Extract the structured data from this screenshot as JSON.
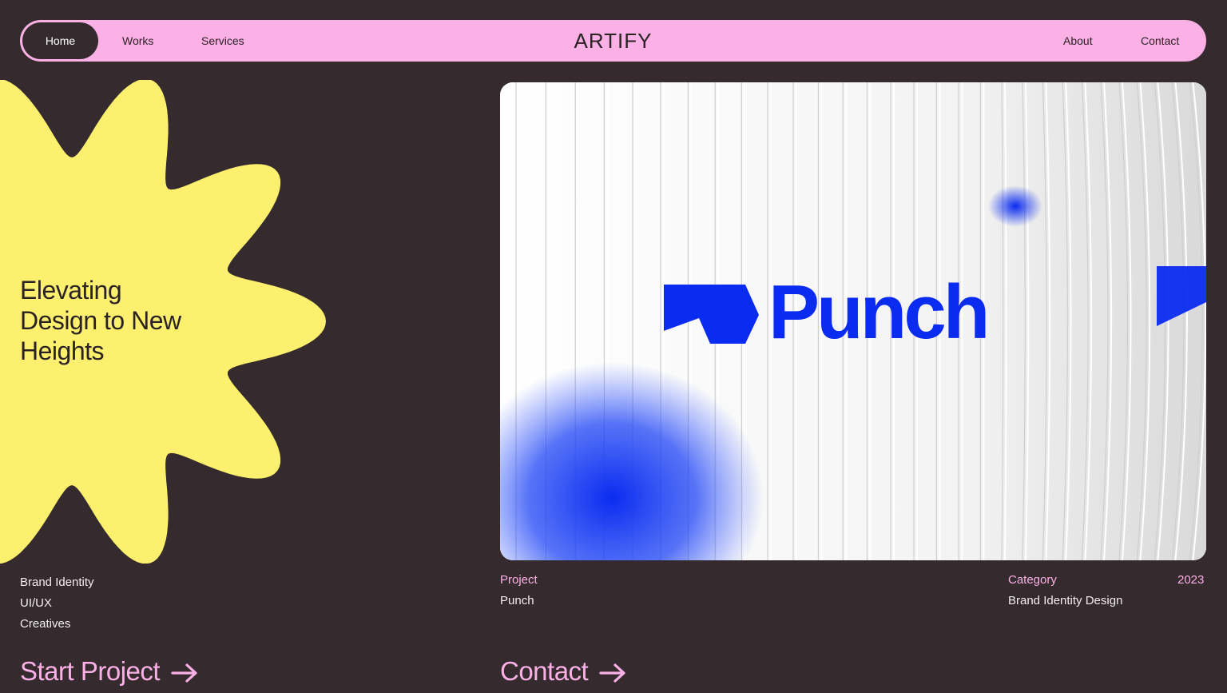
{
  "nav": {
    "home": "Home",
    "works": "Works",
    "services": "Services",
    "brand": "ARTIFY",
    "about": "About",
    "contact": "Contact"
  },
  "hero": {
    "headline_line1": "Elevating",
    "headline_line2": "Design to New",
    "headline_line3": "Heights",
    "tags": [
      "Brand Identity",
      "UI/UX",
      "Creatives"
    ],
    "cta_start": "Start Project"
  },
  "project": {
    "image_wordmark": "Punch",
    "project_label": "Project",
    "project_value": "Punch",
    "category_label": "Category",
    "category_value": "Brand Identity Design",
    "year": "2023",
    "cta_contact": "Contact"
  },
  "colors": {
    "background": "#352a2d",
    "accent_pink": "#fbb0e6",
    "flower_yellow": "#fcf06e",
    "punch_blue": "#0a2bf0"
  }
}
